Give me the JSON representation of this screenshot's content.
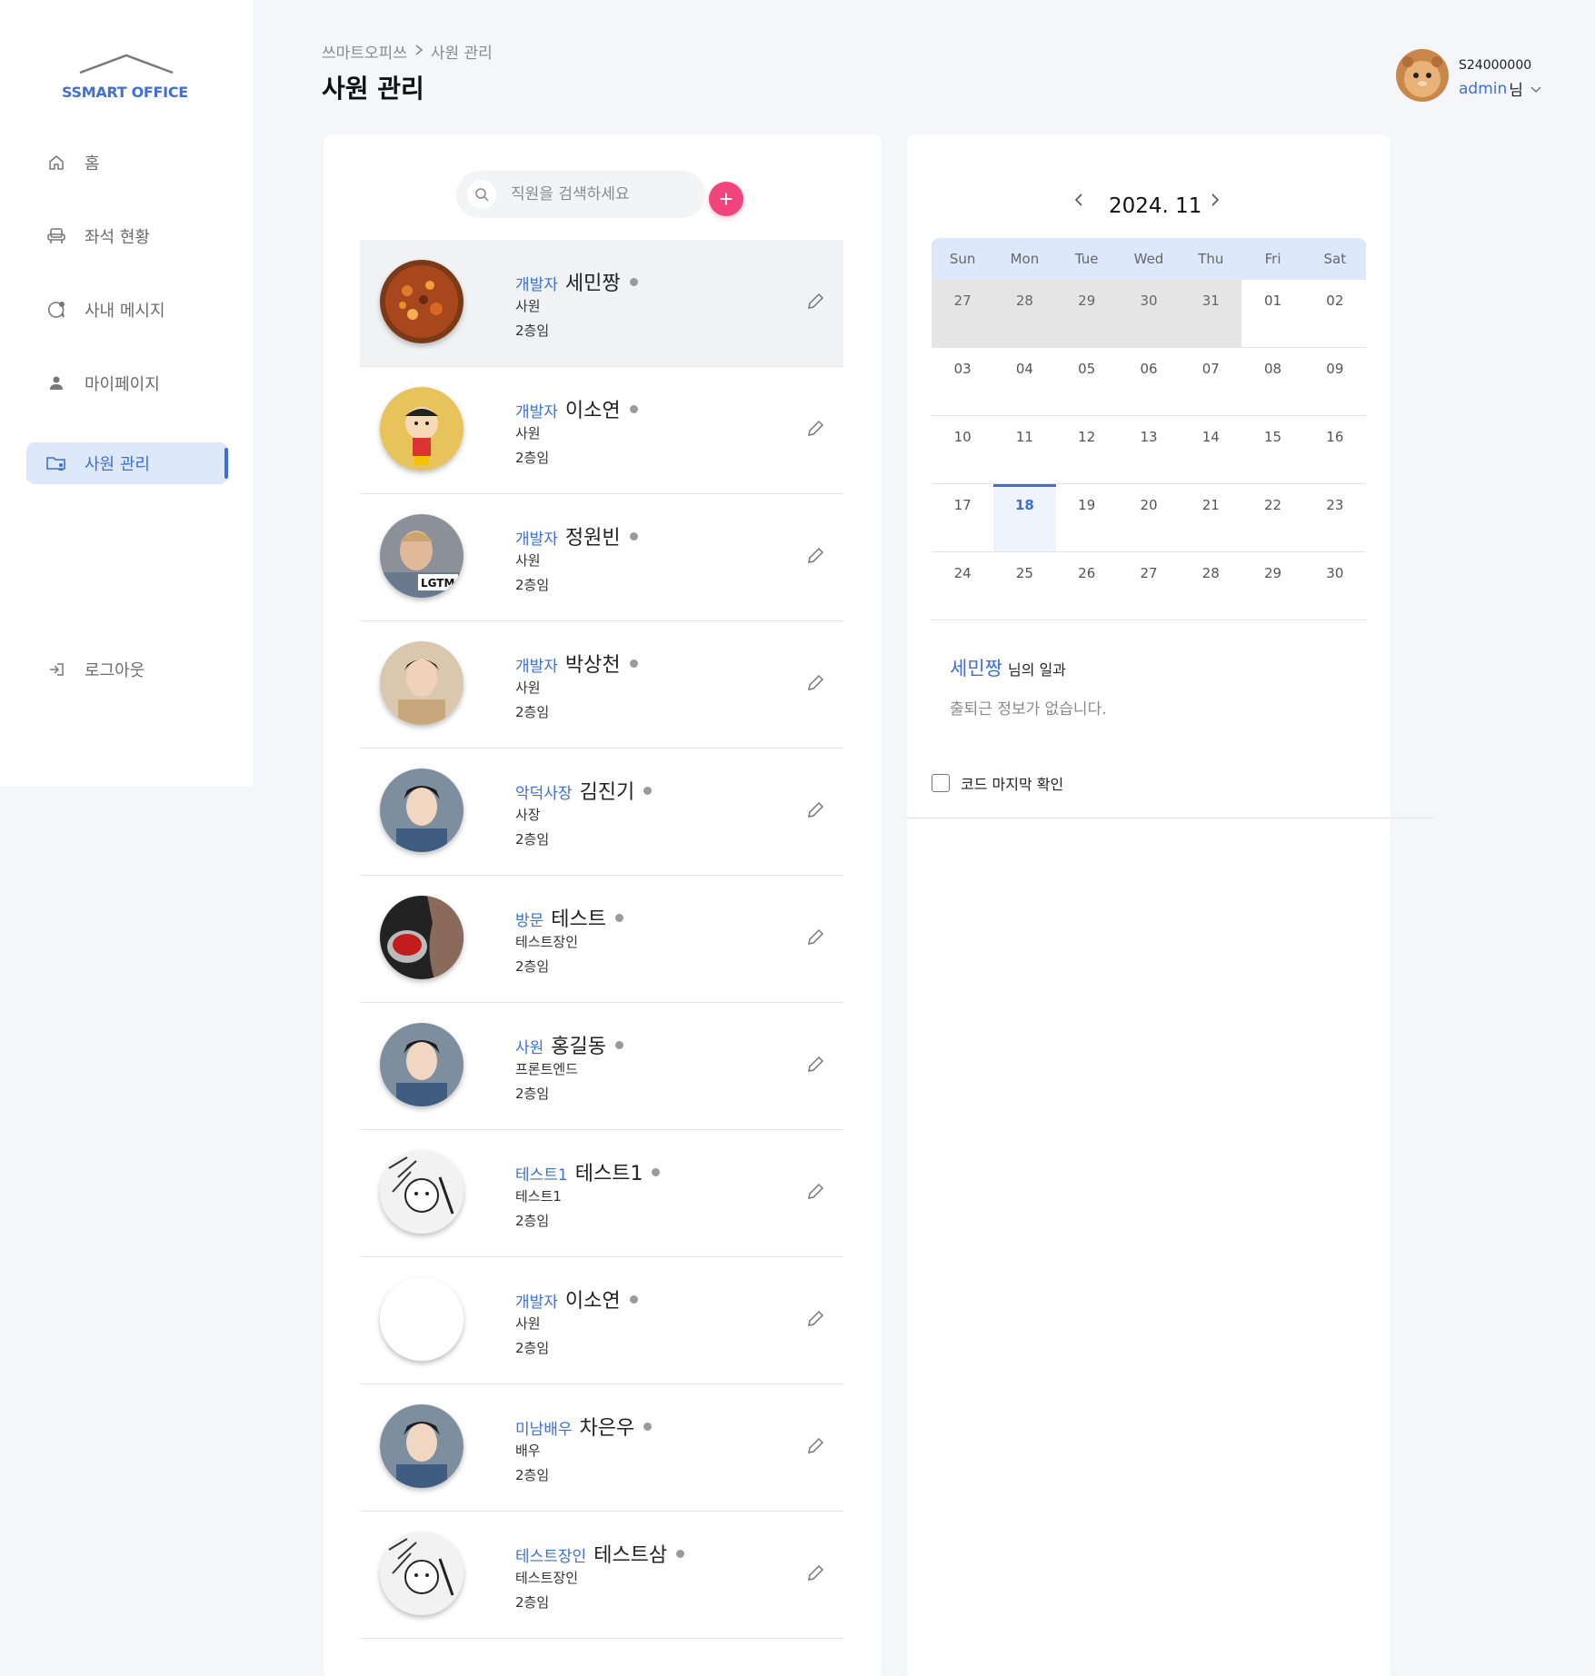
{
  "app": {
    "logo_text": "SSMART OFFICE"
  },
  "sidebar": {
    "items": [
      {
        "label": "홈",
        "icon": "home-icon"
      },
      {
        "label": "좌석 현황",
        "icon": "seat-icon"
      },
      {
        "label": "사내 메시지",
        "icon": "message-icon"
      },
      {
        "label": "마이페이지",
        "icon": "person-icon"
      },
      {
        "label": "사원 관리",
        "icon": "folder-user-icon",
        "active": true
      }
    ],
    "logout": {
      "label": "로그아웃",
      "icon": "logout-icon"
    }
  },
  "header": {
    "breadcrumb": [
      "쓰마트오피쓰",
      "사원 관리"
    ],
    "title": "사원 관리"
  },
  "user": {
    "id": "S24000000",
    "name": "admin",
    "suffix": "님"
  },
  "search": {
    "placeholder": "직원을 검색하세요",
    "add_label": "+"
  },
  "employees": [
    {
      "role": "개발자",
      "name": "세민짱",
      "position": "사원",
      "floor": "2층임",
      "selected": true
    },
    {
      "role": "개발자",
      "name": "이소연",
      "position": "사원",
      "floor": "2층임"
    },
    {
      "role": "개발자",
      "name": "정원빈",
      "position": "사원",
      "floor": "2층임"
    },
    {
      "role": "개발자",
      "name": "박상천",
      "position": "사원",
      "floor": "2층임"
    },
    {
      "role": "악덕사장",
      "name": "김진기",
      "position": "사장",
      "floor": "2층임"
    },
    {
      "role": "방문",
      "name": "테스트",
      "position": "테스트장인",
      "floor": "2층임"
    },
    {
      "role": "사원",
      "name": "홍길동",
      "position": "프론트엔드",
      "floor": "2층임"
    },
    {
      "role": "테스트1",
      "name": "테스트1",
      "position": "테스트1",
      "floor": "2층임"
    },
    {
      "role": "개발자",
      "name": "이소연",
      "position": "사원",
      "floor": "2층임"
    },
    {
      "role": "미남배우",
      "name": "차은우",
      "position": "배우",
      "floor": "2층임"
    },
    {
      "role": "테스트장인",
      "name": "테스트삼",
      "position": "테스트장인",
      "floor": "2층임"
    }
  ],
  "calendar": {
    "title": "2024. 11",
    "weekdays": [
      "Sun",
      "Mon",
      "Tue",
      "Wed",
      "Thu",
      "Fri",
      "Sat"
    ],
    "weeks": [
      [
        "27",
        "28",
        "29",
        "30",
        "31",
        "01",
        "02"
      ],
      [
        "03",
        "04",
        "05",
        "06",
        "07",
        "08",
        "09"
      ],
      [
        "10",
        "11",
        "12",
        "13",
        "14",
        "15",
        "16"
      ],
      [
        "17",
        "18",
        "19",
        "20",
        "21",
        "22",
        "23"
      ],
      [
        "24",
        "25",
        "26",
        "27",
        "28",
        "29",
        "30"
      ]
    ],
    "prev_month_days": 5,
    "today": "18"
  },
  "work": {
    "name": "세민짱",
    "suffix": "님의 일과",
    "empty": "출퇴근 정보가 없습니다."
  },
  "check": {
    "label": "코드 마지막 확인",
    "checked": false
  },
  "colors": {
    "accent": "#3b6fdc",
    "add_button": "#f2447c",
    "active_bg": "#dde8fb"
  }
}
